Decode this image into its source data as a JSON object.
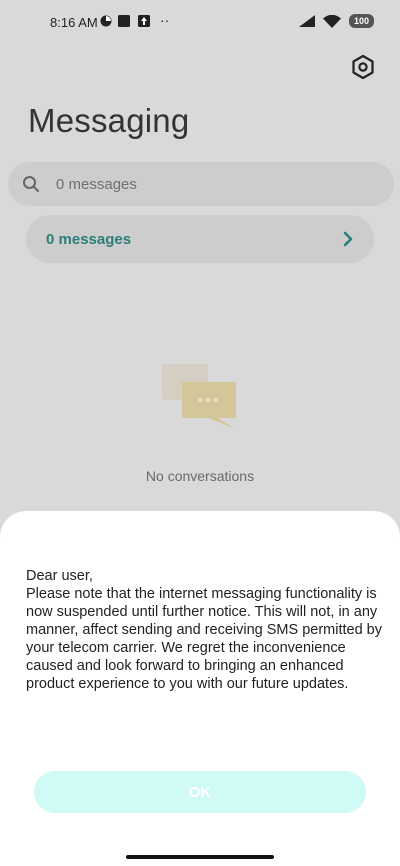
{
  "status_bar": {
    "time": "8:16 AM",
    "more": "··",
    "battery": "100"
  },
  "header": {
    "title": "Messaging"
  },
  "search": {
    "placeholder": "0 messages"
  },
  "folder": {
    "label": "0 messages"
  },
  "empty_state": {
    "text": "No conversations"
  },
  "dialog": {
    "greeting": "Dear user,",
    "body": "Please note that the internet messaging functionality is now suspended until further notice. This will not, in any manner, affect sending and receiving SMS permitted by your telecom carrier. We regret the inconvenience caused and look forward to bringing an enhanced product experience to you with our future updates.",
    "ok_label": "OK"
  },
  "colors": {
    "accent": "#2a7f7a",
    "button_bg": "#cffaf5",
    "scrim": "#d9d9d9"
  }
}
